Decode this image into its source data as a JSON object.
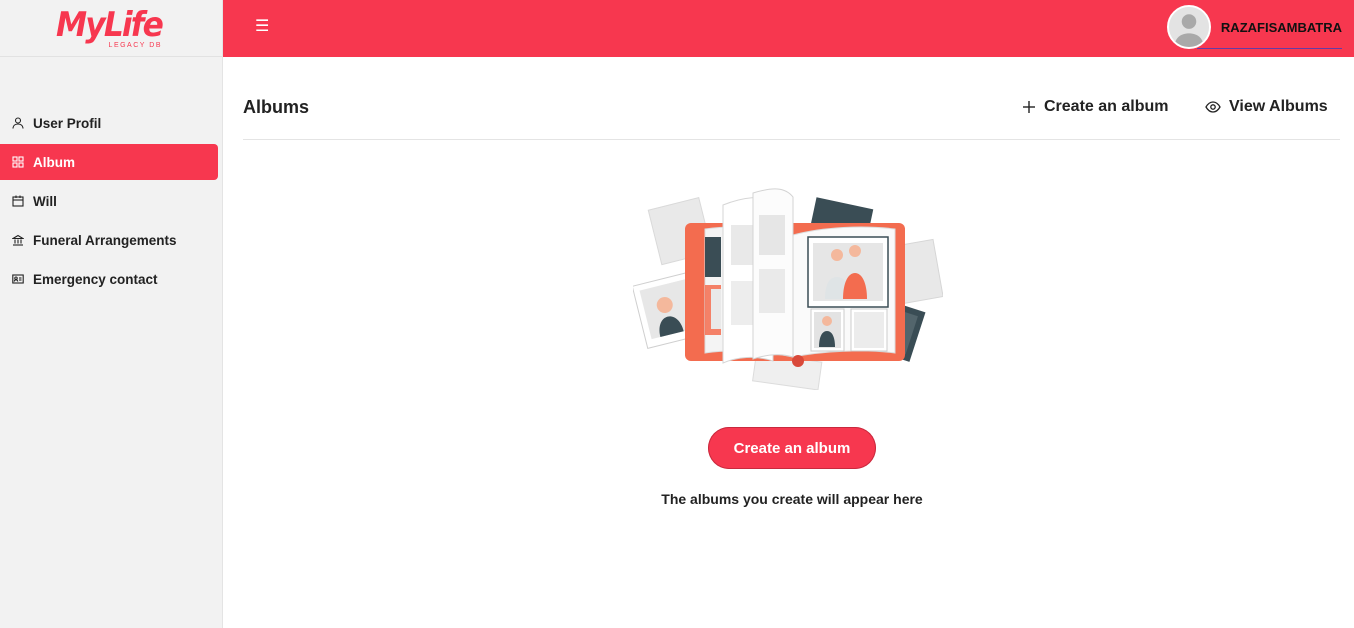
{
  "app": {
    "logo_text": "MyLife",
    "logo_subtext": "LEGACY DB",
    "brand_color": "#f7374f"
  },
  "sidebar": {
    "items": [
      {
        "label": "User Profil",
        "icon": "user-icon",
        "active": false
      },
      {
        "label": "Album",
        "icon": "grid-icon",
        "active": true
      },
      {
        "label": "Will",
        "icon": "calendar-icon",
        "active": false
      },
      {
        "label": "Funeral Arrangements",
        "icon": "bank-icon",
        "active": false
      },
      {
        "label": "Emergency contact",
        "icon": "id-card-icon",
        "active": false
      }
    ]
  },
  "topbar": {
    "menu_icon": "hamburger-icon",
    "username": "RAZAFISAMBATRA",
    "avatar_icon": "user-avatar-icon"
  },
  "main": {
    "title": "Albums",
    "create_album_label": "Create an album",
    "create_album_icon": "plus-icon",
    "view_albums_label": "View Albums",
    "view_albums_icon": "eye-icon",
    "cta_label": "Create an album",
    "empty_message": "The albums you create will appear here"
  }
}
